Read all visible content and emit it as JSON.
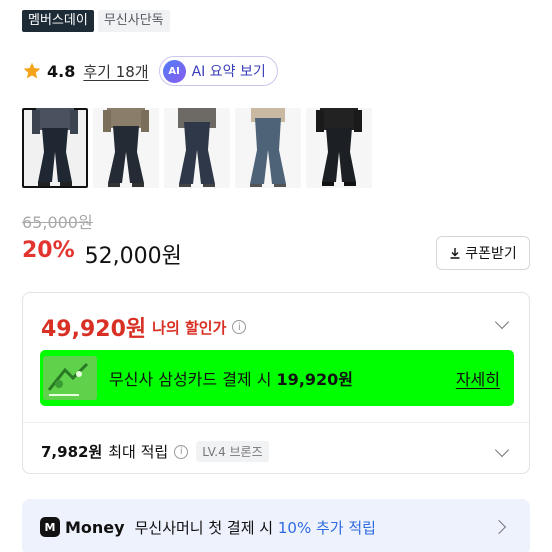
{
  "badges": [
    "멤버스데이",
    "무신사단독"
  ],
  "rating": {
    "score": "4.8",
    "reviews_label": "후기 18개",
    "ai_icon": "AI",
    "ai_label": "AI 요약 보기"
  },
  "thumbnails": [
    {
      "name": "product-thumb-1",
      "selected": true
    },
    {
      "name": "product-thumb-2",
      "selected": false
    },
    {
      "name": "product-thumb-3",
      "selected": false
    },
    {
      "name": "product-thumb-4",
      "selected": false
    },
    {
      "name": "product-thumb-5",
      "selected": false
    }
  ],
  "price": {
    "original": "65,000원",
    "discount": "20%",
    "sale": "52,000원",
    "coupon_label": "쿠폰받기"
  },
  "benefits": {
    "my_price": "49,920원",
    "my_price_label": "나의 할인가",
    "promo_prefix": "무신사 삼성카드 결제 시 ",
    "promo_amount": "19,920원",
    "promo_link": "자세히",
    "points": "7,982원",
    "points_label": "최대 적립",
    "level": "LV.4 브론즈"
  },
  "money": {
    "logo": "M",
    "brand": "Money",
    "text": "무신사머니 첫 결제 시 ",
    "highlight": "10% 추가 적립"
  },
  "colors": {
    "accent_red": "#e3342f",
    "promo_green": "#00ff00",
    "money_blue": "#2f6be0"
  }
}
